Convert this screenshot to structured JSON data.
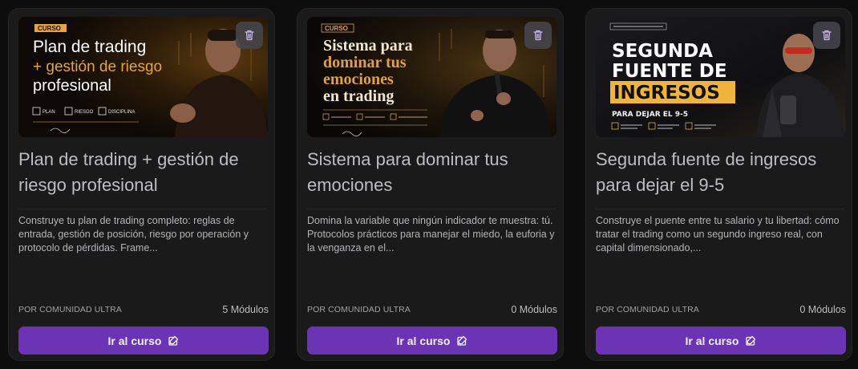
{
  "courses": [
    {
      "banner": {
        "badge": "CURSO",
        "heading_lines": [
          "Plan de trading",
          "+ gestión de riesgo",
          "profesional"
        ],
        "tags": [
          "PLAN",
          "RIESGO",
          "DISCIPLINA"
        ],
        "accent": "#e8a534"
      },
      "title": "Plan de trading + gestión de riesgo profesional",
      "description": "Construye tu plan de trading completo: reglas de entrada, gestión de posición, riesgo por operación y protocolo de pérdidas. Frame...",
      "author": "POR COMUNIDAD ULTRA",
      "modules": "5 Módulos",
      "cta_label": "Ir al curso"
    },
    {
      "banner": {
        "badge": "CURSO",
        "heading_lines": [
          "Sistema para",
          "dominar tus",
          "emociones",
          "en trading"
        ],
        "accent": "#e3a13b"
      },
      "title": "Sistema para dominar tus emociones",
      "description": "Domina la variable que ningún indicador te muestra: tú. Protocolos prácticos para manejar el miedo, la euforia y la venganza en el...",
      "author": "POR COMUNIDAD ULTRA",
      "modules": "0 Módulos",
      "cta_label": "Ir al curso"
    },
    {
      "banner": {
        "heading_lines": [
          "SEGUNDA",
          "FUENTE DE",
          "INGRESOS"
        ],
        "subheading": "PARA DEJAR EL 9-5",
        "accent": "#f0b43a"
      },
      "title": "Segunda fuente de ingresos para dejar el 9-5",
      "description": "Construye el puente entre tu salario y tu libertad: cómo tratar el trading como un segundo ingreso real, con capital dimensionado,...",
      "author": "POR COMUNIDAD ULTRA",
      "modules": "0 Módulos",
      "cta_label": "Ir al curso"
    }
  ],
  "icons": {
    "delete": "trash-icon",
    "external": "external-link-icon"
  },
  "colors": {
    "cta": "#6b33b5",
    "card": "#1a1a1b",
    "background": "#0d0d0e"
  }
}
